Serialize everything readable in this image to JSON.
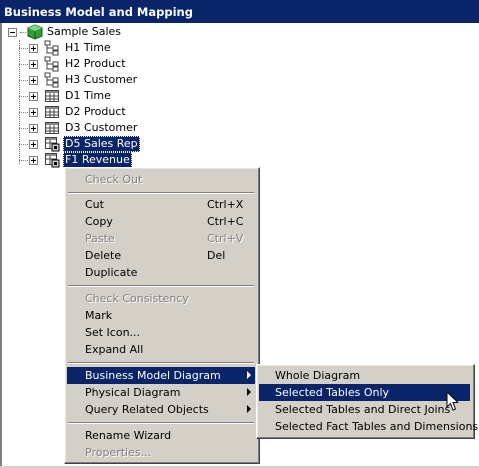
{
  "window": {
    "title": "Business Model and Mapping"
  },
  "tree": {
    "root": {
      "label": "Sample Sales",
      "icon": "cube-icon"
    },
    "items": [
      {
        "label": "H1 Time",
        "icon": "hierarchy-icon",
        "selected": false
      },
      {
        "label": "H2 Product",
        "icon": "hierarchy-icon",
        "selected": false
      },
      {
        "label": "H3 Customer",
        "icon": "hierarchy-icon",
        "selected": false
      },
      {
        "label": "D1 Time",
        "icon": "table-icon",
        "selected": false
      },
      {
        "label": "D2 Product",
        "icon": "table-icon",
        "selected": false
      },
      {
        "label": "D3 Customer",
        "icon": "table-icon",
        "selected": false
      },
      {
        "label": "D5 Sales Rep",
        "icon": "fact-table-icon",
        "selected": true
      },
      {
        "label": "F1 Revenue",
        "icon": "fact-table-icon",
        "selected": true
      }
    ]
  },
  "context_menu": {
    "check_out": "Check Out",
    "cut": "Cut",
    "cut_shortcut": "Ctrl+X",
    "copy": "Copy",
    "copy_shortcut": "Ctrl+C",
    "paste": "Paste",
    "paste_shortcut": "Ctrl+V",
    "delete": "Delete",
    "delete_shortcut": "Del",
    "duplicate": "Duplicate",
    "check_consistency": "Check Consistency",
    "mark": "Mark",
    "set_icon": "Set Icon...",
    "expand_all": "Expand All",
    "business_model_diagram": "Business Model Diagram",
    "physical_diagram": "Physical Diagram",
    "query_related_objects": "Query Related Objects",
    "rename_wizard": "Rename Wizard",
    "properties": "Properties..."
  },
  "submenu": {
    "whole_diagram": "Whole Diagram",
    "selected_tables_only": "Selected Tables Only",
    "selected_tables_direct_joins": "Selected Tables and Direct Joins",
    "selected_fact_tables_dimensions": "Selected Fact Tables and Dimensions"
  },
  "colors": {
    "selection": "#0a246a",
    "menu_face": "#d4d0c8",
    "disabled_text": "#808080"
  }
}
